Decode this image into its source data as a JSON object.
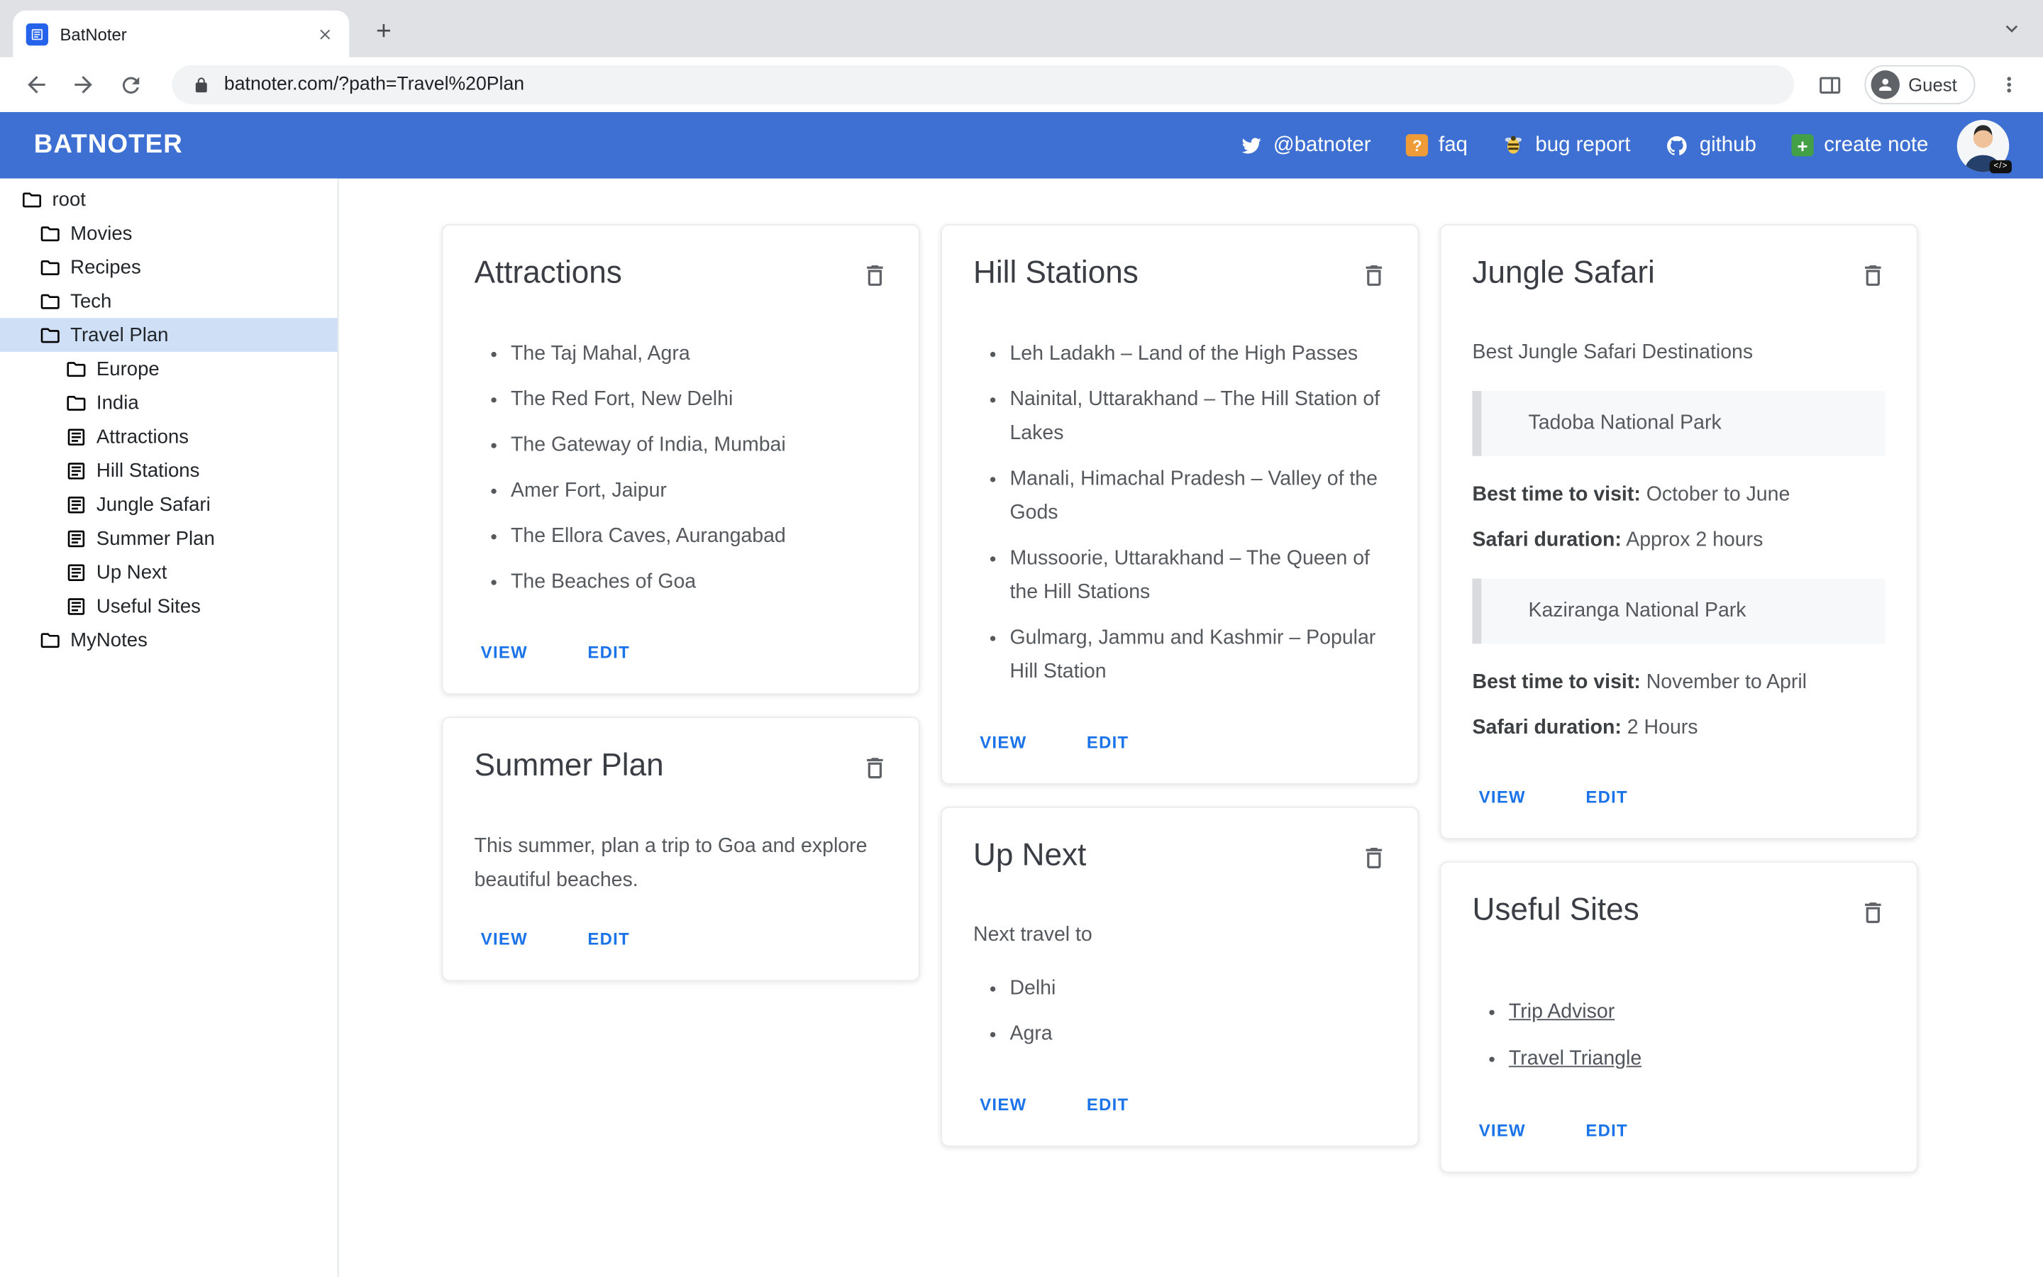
{
  "browser": {
    "tab_title": "BatNoter",
    "url": "batnoter.com/?path=Travel%20Plan",
    "guest_label": "Guest"
  },
  "header": {
    "brand": "BATNOTER",
    "accent_color": "#3d70d2",
    "nav": [
      {
        "label": "@batnoter",
        "icon": "twitter-icon"
      },
      {
        "label": "faq",
        "icon": "faq-icon"
      },
      {
        "label": "bug report",
        "icon": "bee-icon"
      },
      {
        "label": "github",
        "icon": "github-icon"
      },
      {
        "label": "create note",
        "icon": "create-note-icon"
      }
    ]
  },
  "sidebar": {
    "items": [
      {
        "label": "root",
        "type": "folder",
        "level": 0,
        "selected": false
      },
      {
        "label": "Movies",
        "type": "folder",
        "level": 1,
        "selected": false
      },
      {
        "label": "Recipes",
        "type": "folder",
        "level": 1,
        "selected": false
      },
      {
        "label": "Tech",
        "type": "folder",
        "level": 1,
        "selected": false
      },
      {
        "label": "Travel Plan",
        "type": "folder",
        "level": 1,
        "selected": true
      },
      {
        "label": "Europe",
        "type": "folder",
        "level": 2,
        "selected": false
      },
      {
        "label": "India",
        "type": "folder",
        "level": 2,
        "selected": false
      },
      {
        "label": "Attractions",
        "type": "note",
        "level": 2,
        "selected": false
      },
      {
        "label": "Hill Stations",
        "type": "note",
        "level": 2,
        "selected": false
      },
      {
        "label": "Jungle Safari",
        "type": "note",
        "level": 2,
        "selected": false
      },
      {
        "label": "Summer Plan",
        "type": "note",
        "level": 2,
        "selected": false
      },
      {
        "label": "Up Next",
        "type": "note",
        "level": 2,
        "selected": false
      },
      {
        "label": "Useful Sites",
        "type": "note",
        "level": 2,
        "selected": false
      },
      {
        "label": "MyNotes",
        "type": "folder",
        "level": 1,
        "selected": false
      }
    ]
  },
  "cards": {
    "view_label": "VIEW",
    "edit_label": "EDIT",
    "attractions": {
      "title": "Attractions",
      "items": [
        "The Taj Mahal, Agra",
        "The Red Fort, New Delhi",
        "The Gateway of India, Mumbai",
        "Amer Fort, Jaipur",
        "The Ellora Caves, Aurangabad",
        "The Beaches of Goa"
      ]
    },
    "summer_plan": {
      "title": "Summer Plan",
      "body": "This summer, plan a trip to Goa and explore beautiful beaches."
    },
    "hill_stations": {
      "title": "Hill Stations",
      "items": [
        "Leh Ladakh – Land of the High Passes",
        "Nainital, Uttarakhand – The Hill Station of Lakes",
        "Manali, Himachal Pradesh – Valley of the Gods",
        "Mussoorie, Uttarakhand – The Queen of the Hill Stations",
        "Gulmarg, Jammu and Kashmir – Popular Hill Station"
      ]
    },
    "up_next": {
      "title": "Up Next",
      "intro": "Next travel to",
      "items": [
        "Delhi",
        "Agra"
      ]
    },
    "jungle_safari": {
      "title": "Jungle Safari",
      "intro": "Best Jungle Safari Destinations",
      "best_time_label": "Best time to visit:",
      "duration_label": "Safari duration:",
      "parks": [
        {
          "name": "Tadoba National Park",
          "best_time": " October to June",
          "duration": " Approx 2 hours"
        },
        {
          "name": "Kaziranga National Park",
          "best_time": " November to April",
          "duration": " 2 Hours"
        }
      ]
    },
    "useful_sites": {
      "title": "Useful Sites",
      "links": [
        "Trip Advisor",
        "Travel Triangle"
      ]
    }
  }
}
